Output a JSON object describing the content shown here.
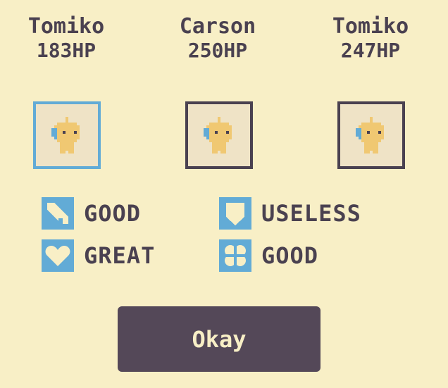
{
  "characters": [
    {
      "name": "Tomiko",
      "hp": "183HP",
      "selected": true
    },
    {
      "name": "Carson",
      "hp": "250HP",
      "selected": false
    },
    {
      "name": "Tomiko",
      "hp": "247HP",
      "selected": false
    }
  ],
  "stats": [
    {
      "icon": "sword-icon",
      "label": "GOOD"
    },
    {
      "icon": "shield-icon",
      "label": "USELESS"
    },
    {
      "icon": "heart-icon",
      "label": "GREAT"
    },
    {
      "icon": "clover-icon",
      "label": "GOOD"
    }
  ],
  "button": {
    "label": "Okay"
  },
  "colors": {
    "background": "#f8efc6",
    "text": "#4a4150",
    "accent": "#62abd6",
    "button": "#544858",
    "portrait_bg": "#efe3c6",
    "sprite_body": "#f0c872"
  }
}
